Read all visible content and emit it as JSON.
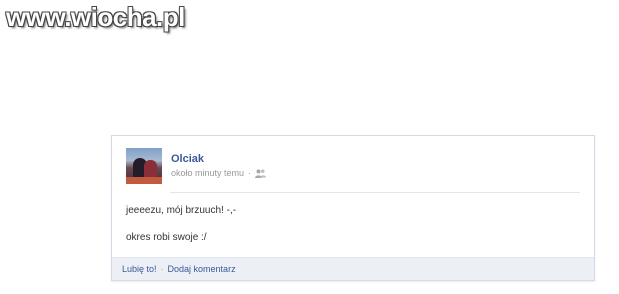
{
  "watermark": {
    "text": "www.wiocha.pl"
  },
  "post": {
    "author": "Olciak",
    "timestamp": "około minuty temu",
    "separator": "·",
    "audience_icon": "friends-icon",
    "lines": [
      "jeeeezu, mój brzuuch! -,-",
      "okres robi swoje :/"
    ],
    "actions": {
      "like_label": "Lubię to!",
      "separator": "·",
      "comment_label": "Dodaj komentarz"
    }
  },
  "colors": {
    "link": "#3b5998",
    "meta": "#999999",
    "footer_bg": "#eceff5"
  }
}
